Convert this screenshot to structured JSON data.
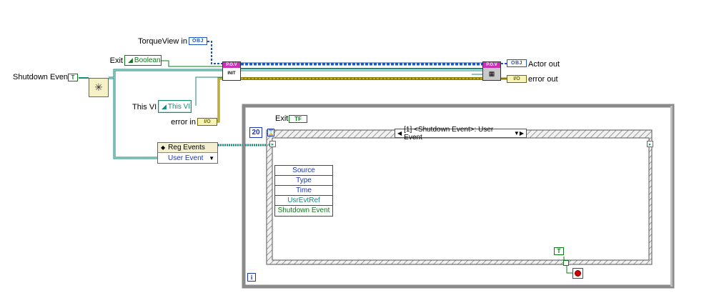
{
  "controls": {
    "torqueview_label": "TorqueView in",
    "torqueview_tag": "OBJ",
    "exit_label": "Exit",
    "exit_value": "Boolean",
    "shutdown_label": "Shutdown Event",
    "shutdown_tag": "T",
    "thisvi_label": "This VI",
    "thisvi_value": "This VI",
    "errorin_label": "error in",
    "errorin_tag": "I/O"
  },
  "indicators": {
    "actor_out_label": "Actor out",
    "actor_out_tag": "OBJ",
    "error_out_label": "error out",
    "error_out_tag": "I/O"
  },
  "nodes": {
    "init_band": "P.O.V",
    "init_text": "INIT",
    "out_band": "P.O.V",
    "reg_events_title": "Reg Events",
    "reg_events_type": "User Event"
  },
  "loop": {
    "exit_label": "Exit",
    "exit_tag": "TF",
    "timeout_value": "20",
    "case_selector": "[1] <Shutdown Event>: User Event",
    "stop_bool_tag": "T",
    "info_icon": "i"
  },
  "event_data": {
    "rows": [
      "Source",
      "Type",
      "Time",
      "UsrEvtRef",
      "Shutdown Event"
    ]
  },
  "colors": {
    "ref_wire": "#178a7a",
    "error_wire": "#8c7d00",
    "obj_wire": "#1b56c9",
    "bool_wire": "#0a7a16"
  }
}
